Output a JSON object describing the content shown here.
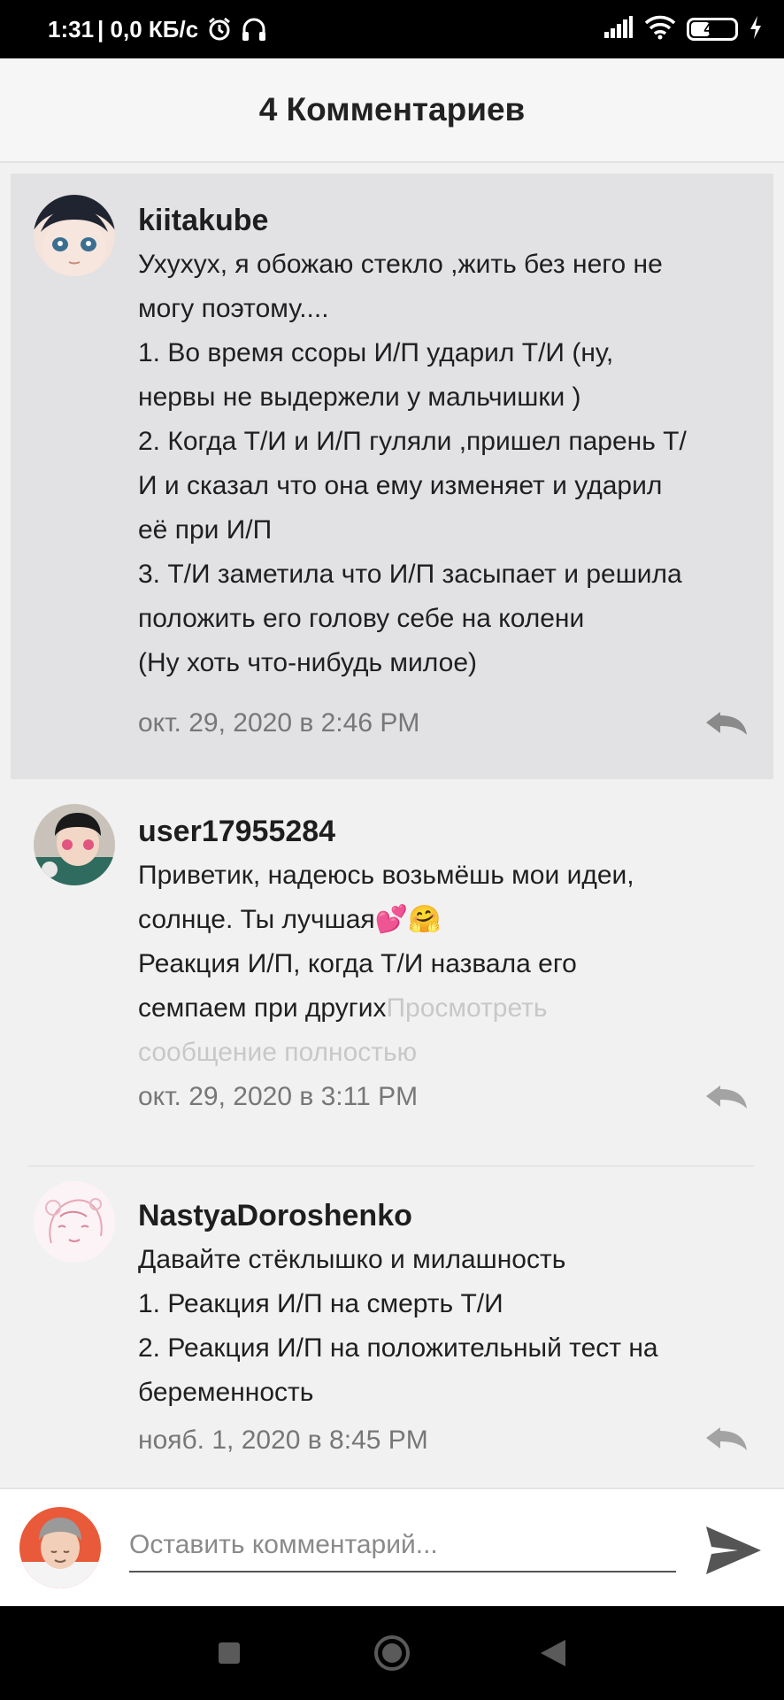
{
  "status_bar": {
    "time": "1:31",
    "network_speed": "| 0,0 КБ/с",
    "battery_level": "42",
    "icons": [
      "alarm-icon",
      "headphones-icon",
      "signal-icon",
      "wifi-icon",
      "battery-icon",
      "charging-icon"
    ]
  },
  "header": {
    "title": "4 Комментариев"
  },
  "comments": [
    {
      "username": "kiitakube",
      "lines": [
        "Ухухух, я обожаю стекло ,жить без него не",
        "могу поэтому....",
        "1. Во время ссоры И/П ударил Т/И (ну,",
        "нервы не выдержели у мальчишки )",
        "2. Когда Т/И и И/П гуляли ,пришел парень Т/",
        "И и сказал что она ему изменяет и ударил",
        "её при И/П",
        "3. Т/И заметила что И/П засыпает и решила",
        "положить его голову себе на колени",
        "(Ну хоть что-нибудь милое)"
      ],
      "date": "окт. 29, 2020 в 2:46 PM",
      "highlighted": true
    },
    {
      "username": "user17955284",
      "lines": [
        "Приветик, надеюсь возьмёшь мои идеи,",
        "солнце. Ты лучшая💕🤗",
        "Реакция И/П, когда Т/И назвала его",
        "семпаем при других"
      ],
      "more_part1": "Просмотреть",
      "more_part2": "сообщение полностью",
      "date": "окт. 29, 2020 в 3:11 PM",
      "highlighted": false
    },
    {
      "username": "NastyaDoroshenko",
      "lines": [
        "Давайте стёклышко и милашность",
        "1. Реакция И/П на смерть Т/И",
        "2. Реакция И/П на положительный тест на",
        "беременность"
      ],
      "date": "нояб. 1, 2020 в 8:45 PM",
      "highlighted": false
    }
  ],
  "composer": {
    "placeholder": "Оставить комментарий..."
  },
  "colors": {
    "highlight_bg": "#e2e1e4",
    "background": "#f1f1f1",
    "muted_text": "#777777",
    "link_faded": "#c8c8c8"
  }
}
